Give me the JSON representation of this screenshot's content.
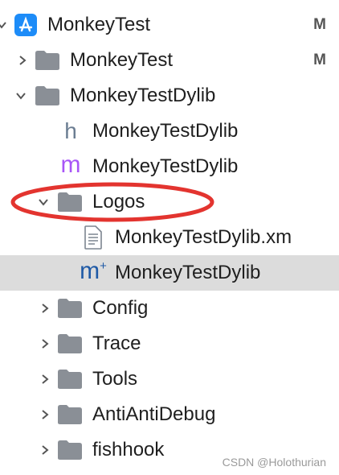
{
  "navigator": {
    "items": [
      {
        "label": "MonkeyTest",
        "icon": "app-project-icon",
        "disclosure": "expanded",
        "badge": "M"
      },
      {
        "label": "MonkeyTest",
        "icon": "folder-icon",
        "disclosure": "collapsed",
        "badge": "M"
      },
      {
        "label": "MonkeyTestDylib",
        "icon": "folder-icon",
        "disclosure": "expanded"
      },
      {
        "label": "MonkeyTestDylib",
        "icon": "header-file-icon",
        "glyph": "h"
      },
      {
        "label": "MonkeyTestDylib",
        "icon": "objc-file-icon",
        "glyph": "m"
      },
      {
        "label": "Logos",
        "icon": "folder-icon",
        "disclosure": "expanded"
      },
      {
        "label": "MonkeyTestDylib.xm",
        "icon": "document-icon"
      },
      {
        "label": "MonkeyTestDylib",
        "icon": "objcpp-file-icon",
        "glyph": "m",
        "selected": true
      },
      {
        "label": "Config",
        "icon": "folder-icon",
        "disclosure": "collapsed"
      },
      {
        "label": "Trace",
        "icon": "folder-icon",
        "disclosure": "collapsed"
      },
      {
        "label": "Tools",
        "icon": "folder-icon",
        "disclosure": "collapsed"
      },
      {
        "label": "AntiAntiDebug",
        "icon": "folder-icon",
        "disclosure": "collapsed"
      },
      {
        "label": "fishhook",
        "icon": "folder-icon",
        "disclosure": "collapsed"
      }
    ]
  },
  "colors": {
    "folder": "#8a8f96",
    "header_glyph": "#6b7d92",
    "objc_glyph": "#a855f7",
    "objcpp_glyph": "#1f5aa6",
    "app_icon": "#1d8cf8",
    "highlight_ellipse": "#e3342f",
    "selection": "#dcdcdc"
  },
  "watermark": "CSDN @Holothurian"
}
